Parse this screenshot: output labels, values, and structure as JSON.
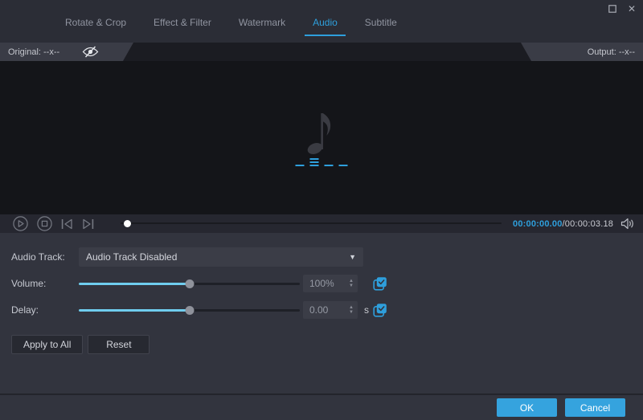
{
  "titlebar": {
    "maximize_icon": "maximize",
    "close_icon": "close",
    "close_glyph": "✕"
  },
  "tabs": [
    {
      "label": "Rotate & Crop",
      "active": false
    },
    {
      "label": "Effect & Filter",
      "active": false
    },
    {
      "label": "Watermark",
      "active": false
    },
    {
      "label": "Audio",
      "active": true
    },
    {
      "label": "Subtitle",
      "active": false
    }
  ],
  "resolution_bar": {
    "original": "Original: --x--",
    "output": "Output: --x--",
    "preview_hidden_icon": "eye-off"
  },
  "preview": {
    "placeholder_icon": "music-note",
    "loading_icon": "equalizer-dashes"
  },
  "player": {
    "current_time": "00:00:00.00",
    "divider": "/",
    "total_time": "00:00:03.18",
    "progress_percent": 1.2,
    "icons": [
      "play",
      "stop",
      "previous-frame",
      "next-frame",
      "speaker"
    ]
  },
  "settings": {
    "audio_track": {
      "label": "Audio Track:",
      "selected": "Audio Track Disabled",
      "arrow": "▼"
    },
    "volume": {
      "label": "Volume:",
      "value": "100%",
      "slider_percent": 50,
      "up": "▲",
      "down": "▼"
    },
    "delay": {
      "label": "Delay:",
      "value": "0.00",
      "unit": "s",
      "slider_percent": 50,
      "up": "▲",
      "down": "▼"
    },
    "apply_to_all_label": "Apply to All",
    "reset_label": "Reset"
  },
  "footer": {
    "ok_label": "OK",
    "cancel_label": "Cancel"
  },
  "colors": {
    "accent_blue": "#2e9fdc",
    "slider_cyan": "#6fcdee",
    "panel_bg": "#32343e",
    "dark_bg": "#2b2d36",
    "preview_bg": "#141519"
  }
}
